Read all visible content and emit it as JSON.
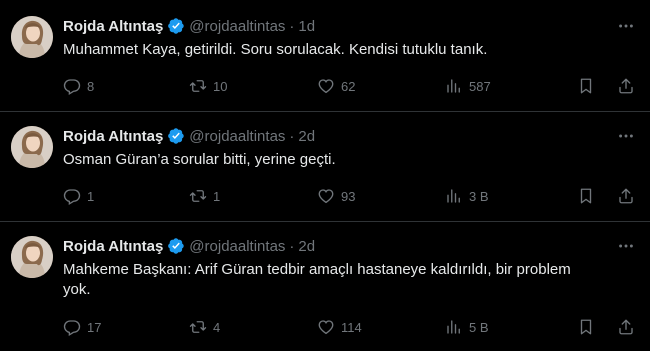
{
  "colors": {
    "background": "#000000",
    "text_primary": "#e7e9ea",
    "text_secondary": "#71767b",
    "divider": "#2f3336",
    "verified": "#1d9bf0"
  },
  "tweets": [
    {
      "author_name": "Rojda Altıntaş",
      "handle": "@rojdaaltintas",
      "separator": "·",
      "time": "1d",
      "text": "Muhammet Kaya, getirildi. Soru sorulacak. Kendisi tutuklu tanık.",
      "replies": "8",
      "reposts": "10",
      "likes": "62",
      "views": "587"
    },
    {
      "author_name": "Rojda Altıntaş",
      "handle": "@rojdaaltintas",
      "separator": "·",
      "time": "2d",
      "text": "Osman Güran’a sorular bitti, yerine geçti.",
      "replies": "1",
      "reposts": "1",
      "likes": "93",
      "views": "3 B"
    },
    {
      "author_name": "Rojda Altıntaş",
      "handle": "@rojdaaltintas",
      "separator": "·",
      "time": "2d",
      "text": "Mahkeme Başkanı: Arif Güran tedbir amaçlı hastaneye kaldırıldı, bir problem yok.",
      "replies": "17",
      "reposts": "4",
      "likes": "114",
      "views": "5 B"
    }
  ],
  "icons": {
    "reply": "reply-icon",
    "repost": "repost-icon",
    "like": "heart-icon",
    "views": "views-bar-chart-icon",
    "bookmark": "bookmark-icon",
    "share": "share-icon",
    "more": "more-dots-icon",
    "verified": "verified-badge-icon"
  }
}
